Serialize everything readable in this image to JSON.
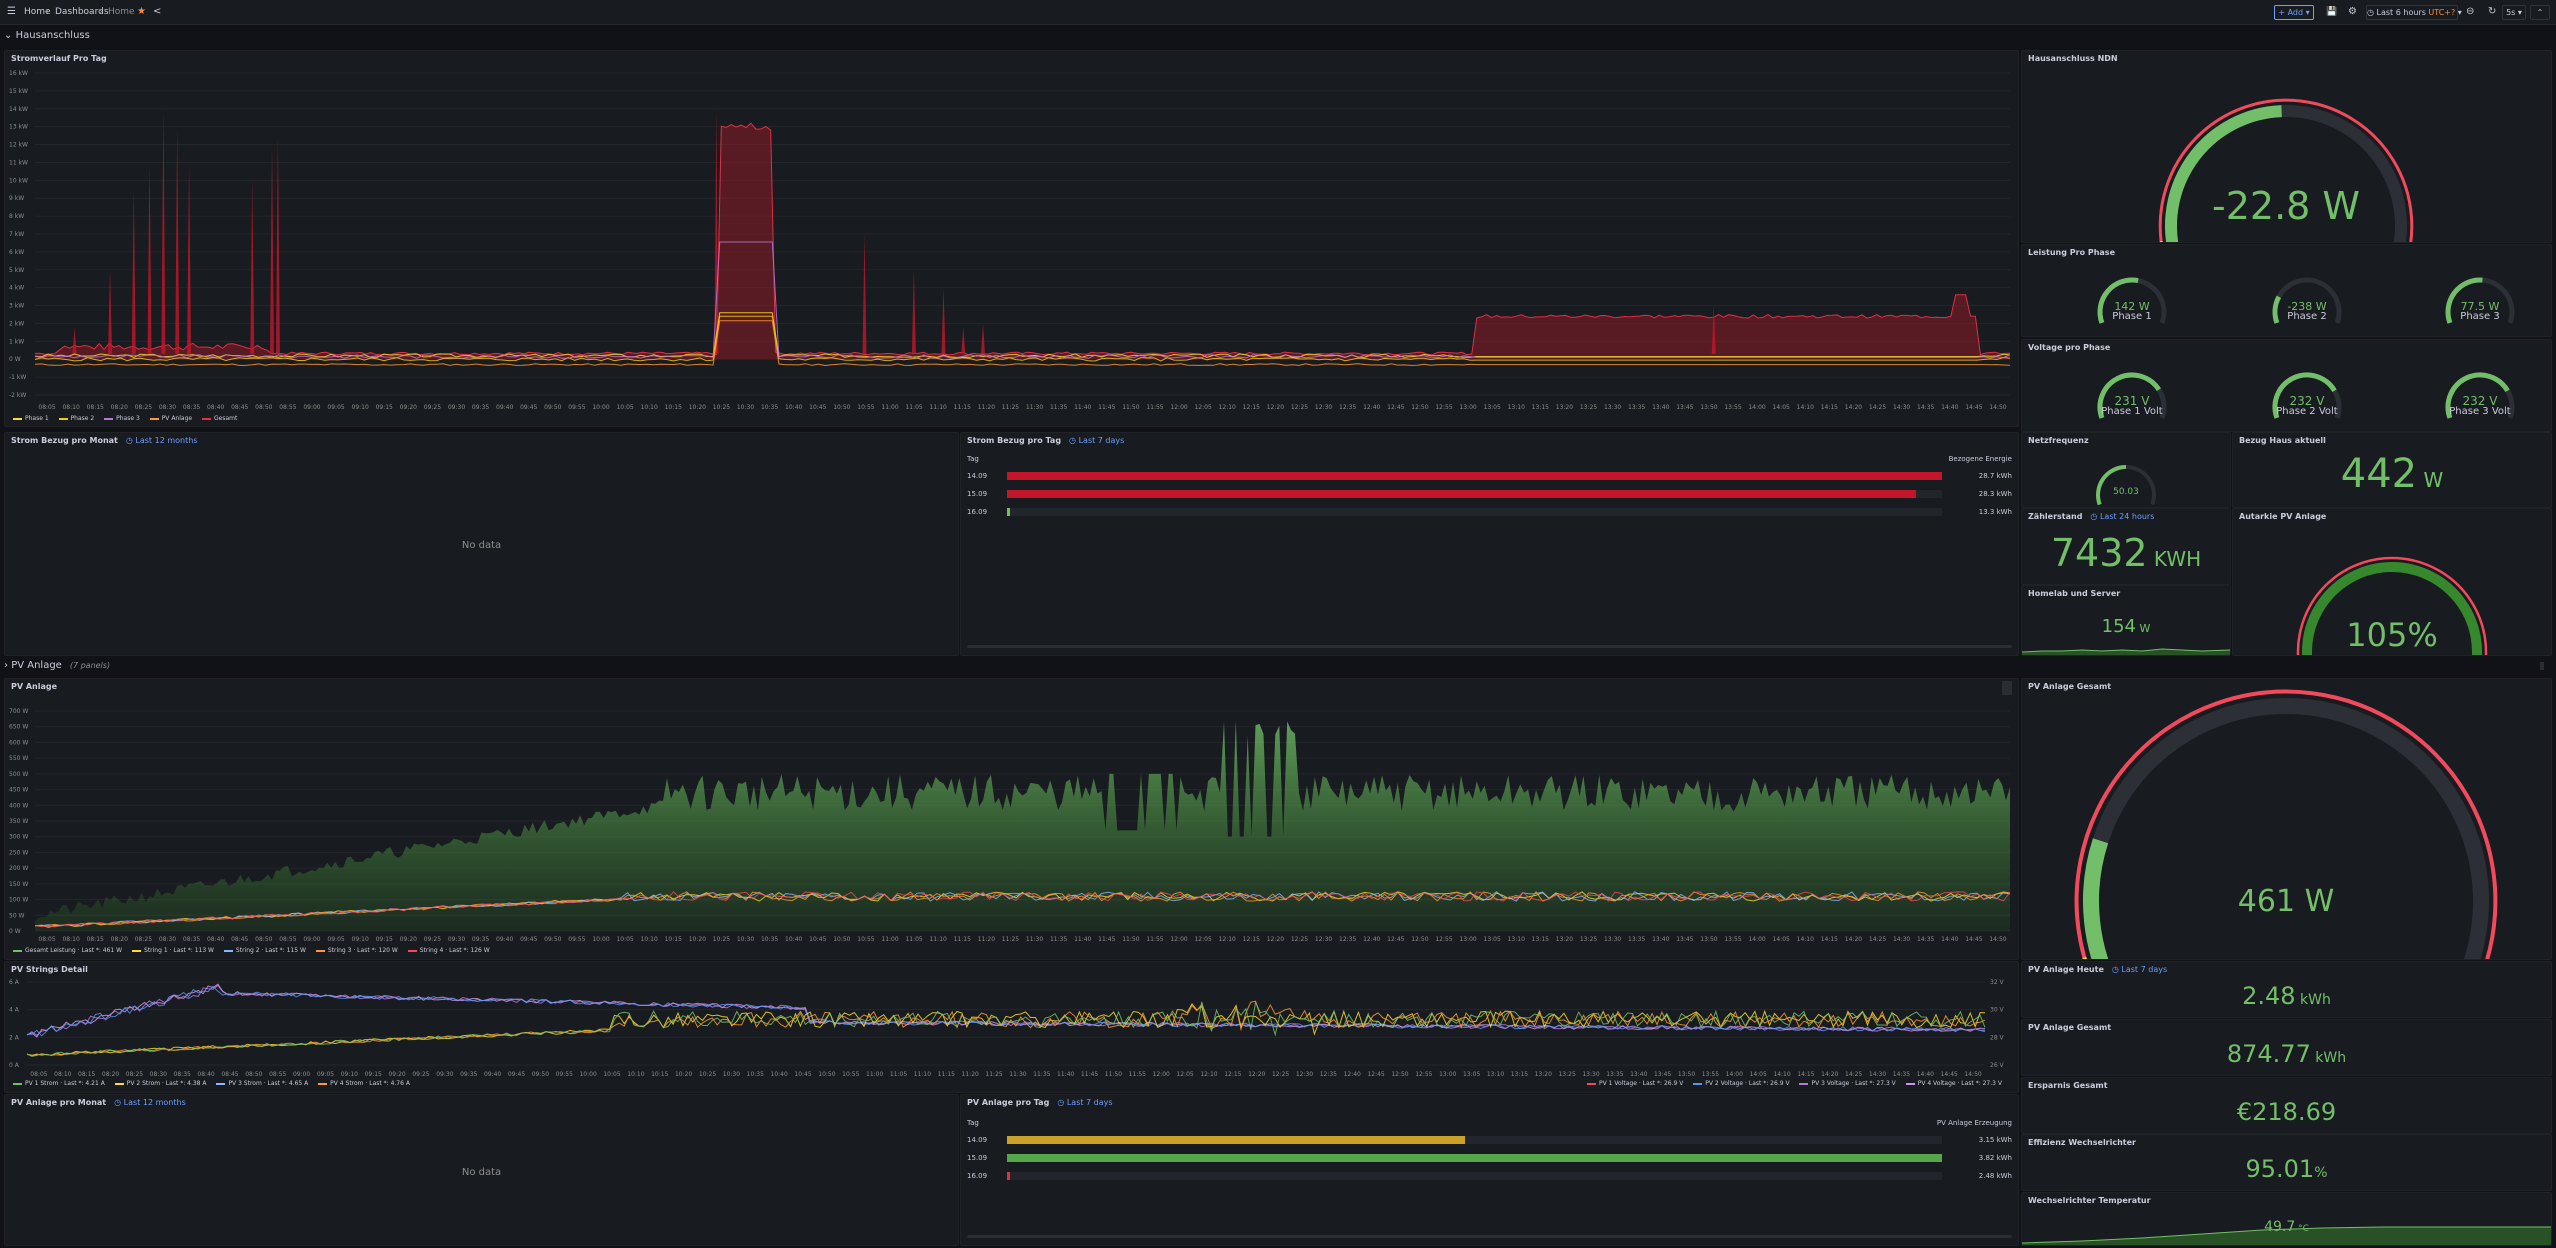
{
  "topbar": {
    "menu_icon": "hamburger-icon",
    "breadcrumb": [
      "Home",
      "Dashboards",
      "Home"
    ],
    "star_icon": "star-icon",
    "share_icon": "share-icon",
    "add_label": "Add",
    "save_icon": "save-icon",
    "settings_icon": "gear-icon",
    "time_range": "Last 6 hours",
    "timezone": "UTC+?",
    "time_icon": "clock-icon",
    "zoom_icon": "zoom-out-icon",
    "refresh_icon": "refresh-icon",
    "refresh_interval": "5s",
    "collapse_icon": "chevron-up-icon"
  },
  "rows": {
    "hausanschluss": {
      "title": "Hausanschluss"
    },
    "pv": {
      "title": "PV Anlage",
      "sub": "(7 panels)"
    }
  },
  "time_ticks": [
    "08:05",
    "08:10",
    "08:15",
    "08:20",
    "08:25",
    "08:30",
    "08:35",
    "08:40",
    "08:45",
    "08:50",
    "08:55",
    "09:00",
    "09:05",
    "09:10",
    "09:15",
    "09:20",
    "09:25",
    "09:30",
    "09:35",
    "09:40",
    "09:45",
    "09:50",
    "09:55",
    "10:00",
    "10:05",
    "10:10",
    "10:15",
    "10:20",
    "10:25",
    "10:30",
    "10:35",
    "10:40",
    "10:45",
    "10:50",
    "10:55",
    "11:00",
    "11:05",
    "11:10",
    "11:15",
    "11:20",
    "11:25",
    "11:30",
    "11:35",
    "11:40",
    "11:45",
    "11:50",
    "11:55",
    "12:00",
    "12:05",
    "12:10",
    "12:15",
    "12:20",
    "12:25",
    "12:30",
    "12:35",
    "12:40",
    "12:45",
    "12:50",
    "12:55",
    "13:00",
    "13:05",
    "13:10",
    "13:15",
    "13:20",
    "13:25",
    "13:30",
    "13:35",
    "13:40",
    "13:45",
    "13:50",
    "13:55",
    "14:00",
    "14:05",
    "14:10",
    "14:15",
    "14:20",
    "14:25",
    "14:30",
    "14:35",
    "14:40",
    "14:45",
    "14:50"
  ],
  "stromverlauf": {
    "title": "Stromverlauf Pro Tag",
    "y_ticks": [
      "16 kW",
      "15 kW",
      "14 kW",
      "13 kW",
      "12 kW",
      "11 kW",
      "10 kW",
      "9 kW",
      "8 kW",
      "7 kW",
      "6 kW",
      "5 kW",
      "4 kW",
      "3 kW",
      "2 kW",
      "1 kW",
      "0 W",
      "-1 kW",
      "-2 kW"
    ],
    "legend": [
      "Phase 1",
      "Phase 2",
      "Phase 3",
      "PV Anlage",
      "Gesamt"
    ],
    "colors": {
      "phase1": "#fade2a",
      "phase2": "#f2cc0c",
      "phase3": "#b877d9",
      "pv": "#ff9830",
      "gesamt": "#e02f44"
    }
  },
  "hausanschluss_ndn": {
    "title": "Hausanschluss NDN",
    "value": "-22.8",
    "unit": "W",
    "level": 0.49
  },
  "leistung": {
    "title": "Leistung Pro Phase",
    "gauges": [
      {
        "value": "142",
        "unit": "W",
        "label": "Phase 1",
        "level": 0.55
      },
      {
        "value": "-238",
        "unit": "W",
        "label": "Phase 2",
        "level": 0.22
      },
      {
        "value": "77.5",
        "unit": "W",
        "label": "Phase 3",
        "level": 0.52
      }
    ]
  },
  "voltage": {
    "title": "Voltage pro Phase",
    "gauges": [
      {
        "value": "231",
        "unit": "V",
        "label": "Phase 1 Volt",
        "level": 0.76
      },
      {
        "value": "232",
        "unit": "V",
        "label": "Phase 2 Volt",
        "level": 0.77
      },
      {
        "value": "232",
        "unit": "V",
        "label": "Phase 3 Volt",
        "level": 0.77
      }
    ]
  },
  "strom_monat": {
    "title": "Strom Bezug pro Monat",
    "range": "Last 12 months",
    "nodata": "No data"
  },
  "strom_tag": {
    "title": "Strom Bezug pro Tag",
    "range": "Last 7 days",
    "col_tag": "Tag",
    "col_val": "Bezogene Energie",
    "rows": [
      {
        "tag": "14.09",
        "value": "28.7 kWh",
        "frac": 1.0
      },
      {
        "tag": "15.09",
        "value": "28.3 kWh",
        "frac": 0.972
      },
      {
        "tag": "16.09",
        "value": "13.3 kWh",
        "frac": 0.002
      }
    ]
  },
  "netzfrequenz": {
    "title": "Netzfrequenz",
    "value": "50.03",
    "level": 0.5
  },
  "bezug_haus": {
    "title": "Bezug Haus aktuell",
    "value": "442",
    "unit": "W"
  },
  "zaehlerstand": {
    "title": "Zählerstand",
    "range": "Last 24 hours",
    "value": "7432",
    "unit": "KWH"
  },
  "autarkie": {
    "title": "Autarkie PV Anlage",
    "value": "105%",
    "level": 0.98
  },
  "homelab": {
    "title": "Homelab und Server",
    "value": "154",
    "unit": "W"
  },
  "pv_anlage": {
    "title": "PV Anlage",
    "y_ticks": [
      "700 W",
      "650 W",
      "600 W",
      "550 W",
      "500 W",
      "450 W",
      "400 W",
      "350 W",
      "300 W",
      "250 W",
      "200 W",
      "150 W",
      "100 W",
      "50 W",
      "0 W"
    ],
    "legend": [
      "Gesamt Leistung · Last *: 461 W",
      "String 1 · Last *: 113 W",
      "String 2 · Last *: 115 W",
      "String 3 · Last *: 120 W",
      "String 4 · Last *: 126 W"
    ]
  },
  "pv_gesamt_gauge": {
    "title": "PV Anlage Gesamt",
    "value": "461",
    "unit": "W",
    "level": 0.2
  },
  "pv_strings": {
    "title": "PV Strings Detail",
    "y_left": [
      "6 A",
      "4 A",
      "2 A",
      "0 A"
    ],
    "y_right": [
      "32 V",
      "30 V",
      "28 V",
      "26 V"
    ],
    "legend_left": [
      "PV 1 Strom · Last *: 4.21 A",
      "PV 2 Strom · Last *: 4.38 A",
      "PV 3 Strom · Last *: 4.65 A",
      "PV 4 Strom · Last *: 4.76 A"
    ],
    "legend_right": [
      "PV 1 Voltage · Last *: 26.9 V",
      "PV 2 Voltage · Last *: 26.9 V",
      "PV 3 Voltage · Last *: 27.3 V",
      "PV 4 Voltage · Last *: 27.3 V"
    ]
  },
  "pv_heute": {
    "title": "PV Anlage Heute",
    "range": "Last 7 days",
    "value": "2.48",
    "unit": "kWh"
  },
  "pv_gesamt_stat": {
    "title": "PV Anlage Gesamt",
    "value": "874.77",
    "unit": "kWh"
  },
  "ersparnis": {
    "title": "Ersparnis Gesamt",
    "value": "€218.69"
  },
  "effizienz": {
    "title": "Effizienz Wechselrichter",
    "value": "95.01",
    "unit": "%"
  },
  "temperatur": {
    "title": "Wechselrichter Temperatur",
    "value": "49.7",
    "unit": "°C"
  },
  "pv_monat": {
    "title": "PV Anlage pro Monat",
    "range": "Last 12 months",
    "nodata": "No data"
  },
  "pv_tag": {
    "title": "PV Anlage pro Tag",
    "range": "Last 7 days",
    "col_tag": "Tag",
    "col_val": "PV Anlage Erzeugung",
    "rows": [
      {
        "tag": "14.09",
        "value": "3.15 kWh",
        "frac": 0.49,
        "color": "#c9a227"
      },
      {
        "tag": "15.09",
        "value": "3.82 kWh",
        "frac": 1.0,
        "color": "#56a64b"
      },
      {
        "tag": "16.09",
        "value": "2.48 kWh",
        "frac": 0.002,
        "color": "#e02f44"
      }
    ]
  }
}
